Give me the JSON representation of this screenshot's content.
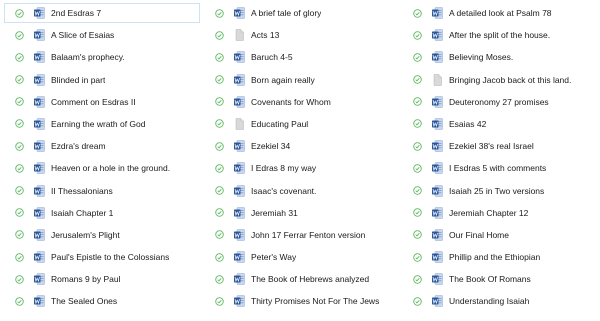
{
  "colors": {
    "synced": "#5eb85e",
    "word_blue": "#2b579a",
    "word_page": "#c9d8ef",
    "generic_page": "#d9d9d9",
    "selected_border": "#cde3f5"
  },
  "columns": [
    {
      "items": [
        {
          "label": "2nd Esdras 7",
          "icon": "word-doc-icon",
          "status": "synced-icon",
          "selected": true
        },
        {
          "label": "A Slice of Esaias",
          "icon": "word-doc-icon",
          "status": "synced-icon"
        },
        {
          "label": "Balaam's prophecy.",
          "icon": "word-doc-icon",
          "status": "synced-icon"
        },
        {
          "label": "Blinded in part",
          "icon": "word-doc-icon",
          "status": "synced-icon"
        },
        {
          "label": "Comment on Esdras II",
          "icon": "word-doc-icon",
          "status": "synced-icon"
        },
        {
          "label": "Earning the wrath of God",
          "icon": "word-doc-icon",
          "status": "synced-icon"
        },
        {
          "label": "Ezdra's dream",
          "icon": "word-doc-icon",
          "status": "synced-icon"
        },
        {
          "label": "Heaven or a hole in the ground.",
          "icon": "word-doc-icon",
          "status": "synced-icon"
        },
        {
          "label": "II Thessalonians",
          "icon": "word-doc-icon",
          "status": "synced-icon"
        },
        {
          "label": "Isaiah Chapter 1",
          "icon": "word-doc-icon",
          "status": "synced-icon"
        },
        {
          "label": "Jerusalem's Plight",
          "icon": "word-doc-icon",
          "status": "synced-icon"
        },
        {
          "label": "Paul's Epistle to the Colossians",
          "icon": "word-doc-icon",
          "status": "synced-icon"
        },
        {
          "label": "Romans 9 by Paul",
          "icon": "word-doc-icon",
          "status": "synced-icon"
        },
        {
          "label": "The Sealed Ones",
          "icon": "word-doc-icon",
          "status": "synced-icon"
        }
      ]
    },
    {
      "items": [
        {
          "label": "A brief tale of glory",
          "icon": "word-doc-icon",
          "status": "synced-icon"
        },
        {
          "label": "Acts 13",
          "icon": "generic-file-icon",
          "status": "synced-icon"
        },
        {
          "label": "Baruch 4-5",
          "icon": "word-doc-icon",
          "status": "synced-icon"
        },
        {
          "label": "Born again  really",
          "icon": "word-doc-icon",
          "status": "synced-icon"
        },
        {
          "label": "Covenants for Whom",
          "icon": "word-doc-icon",
          "status": "synced-icon"
        },
        {
          "label": "Educating Paul",
          "icon": "generic-file-icon",
          "status": "synced-icon"
        },
        {
          "label": "Ezekiel 34",
          "icon": "word-doc-icon",
          "status": "synced-icon"
        },
        {
          "label": "I Edras 8  my way",
          "icon": "word-doc-icon",
          "status": "synced-icon"
        },
        {
          "label": "Isaac's covenant.",
          "icon": "word-doc-icon",
          "status": "synced-icon"
        },
        {
          "label": "Jeremiah 31",
          "icon": "word-doc-icon",
          "status": "synced-icon"
        },
        {
          "label": "John 17 Ferrar Fenton version",
          "icon": "word-doc-icon",
          "status": "synced-icon"
        },
        {
          "label": "Peter's Way",
          "icon": "word-doc-icon",
          "status": "synced-icon"
        },
        {
          "label": "The Book of Hebrews analyzed",
          "icon": "word-doc-icon",
          "status": "synced-icon"
        },
        {
          "label": "Thirty Promises Not For The Jews",
          "icon": "word-doc-icon",
          "status": "synced-icon"
        }
      ]
    },
    {
      "items": [
        {
          "label": "A detailed look at Psalm 78",
          "icon": "word-doc-icon",
          "status": "synced-icon"
        },
        {
          "label": "After the split of the house.",
          "icon": "word-doc-icon",
          "status": "synced-icon"
        },
        {
          "label": "Believing Moses.",
          "icon": "word-doc-icon",
          "status": "synced-icon"
        },
        {
          "label": "Bringing Jacob back ot this land.",
          "icon": "generic-file-icon",
          "status": "synced-icon"
        },
        {
          "label": "Deuteronomy 27 promises",
          "icon": "word-doc-icon",
          "status": "synced-icon"
        },
        {
          "label": "Esaias 42",
          "icon": "word-doc-icon",
          "status": "synced-icon"
        },
        {
          "label": "Ezekiel 38's real Israel",
          "icon": "word-doc-icon",
          "status": "synced-icon"
        },
        {
          "label": "I Esdras 5 with comments",
          "icon": "word-doc-icon",
          "status": "synced-icon"
        },
        {
          "label": "Isaiah 25 in Two versions",
          "icon": "word-doc-icon",
          "status": "synced-icon"
        },
        {
          "label": "Jeremiah Chapter 12",
          "icon": "word-doc-icon",
          "status": "synced-icon"
        },
        {
          "label": "Our Final Home",
          "icon": "word-doc-icon",
          "status": "synced-icon"
        },
        {
          "label": "Phillip and the Ethiopian",
          "icon": "word-doc-icon",
          "status": "synced-icon"
        },
        {
          "label": "The Book Of Romans",
          "icon": "word-doc-icon",
          "status": "synced-icon"
        },
        {
          "label": "Understanding Isaiah",
          "icon": "word-doc-icon",
          "status": "synced-icon"
        }
      ]
    }
  ]
}
